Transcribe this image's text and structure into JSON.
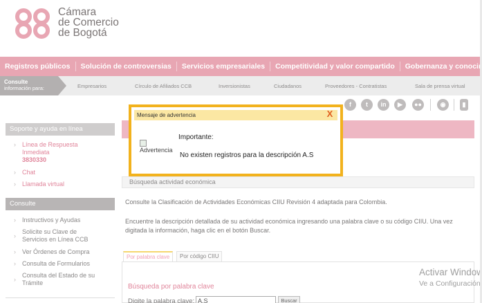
{
  "header": {
    "logo_line1": "Cámara",
    "logo_line2": "de Comercio",
    "logo_line3": "de Bogotá"
  },
  "main_nav": [
    "Registros públicos",
    "Solución de controversias",
    "Servicios empresariales",
    "Competitividad y valor compartido",
    "Gobernanza y conocimiento empresarial"
  ],
  "sub_nav": {
    "consulte_title": "Consulte",
    "consulte_sub": "información para:",
    "items": [
      "Empresarios",
      "Círculo de Afiliados CCB",
      "Inversionistas",
      "Ciudadanos",
      "Proveedores - Contratistas",
      "Sala de prensa virtual"
    ]
  },
  "social_icons": [
    "facebook-icon",
    "twitter-icon",
    "linkedin-icon",
    "youtube-icon",
    "flickr-icon",
    "rss-icon",
    "mobile-icon"
  ],
  "sidebar": {
    "support_title": "Soporte y ayuda en línea",
    "support_items": {
      "linea_l1": "Línea de Respuesta",
      "linea_l2": "Inmediata",
      "phone": "3830330",
      "chat": "Chat",
      "llamada": "Llamada virtual"
    },
    "consulte_title": "Consulte",
    "consulte_items": [
      "Instructivos y Ayudas",
      "Solicite su Clave de Servicios en Línea CCB",
      "Ver Órdenes de Compra",
      "Consulta de Formularios",
      "Consulta del Estado de su Trámite"
    ]
  },
  "content": {
    "section_label": "Búsqueda actividad económica",
    "para1": "Consulte la Clasificación de Actividades Económicas CIIU Revisión 4 adaptada para Colombia.",
    "para2_l1": "Encuentre la descripción detallada de su actividad económica ingresando una palabra clave o su código CIIU. Una vez",
    "para2_l2": "digitada la información, haga clic en el botón Buscar.",
    "tab_keyword": "Por palabra clave",
    "tab_code": "Por código CIIU",
    "search_title": "Búsqueda por palabra clave",
    "search_label": "Digite la palabra clave:",
    "search_value": "A.S",
    "search_button": "Buscar"
  },
  "watermark": {
    "line1": "Activar Windows",
    "line2": "Ve a Configuración"
  },
  "modal": {
    "title": "Mensaje de advertencia",
    "close": "X",
    "image_alt": "Advertencia",
    "heading": "Importante:",
    "message": "No existen registros para la descripción A.S"
  },
  "colors": {
    "nav_pink": "#e8a6b3",
    "link_pink": "#e0849a",
    "modal_border": "#f2b21d",
    "modal_title_bg": "#fbe7a3"
  }
}
